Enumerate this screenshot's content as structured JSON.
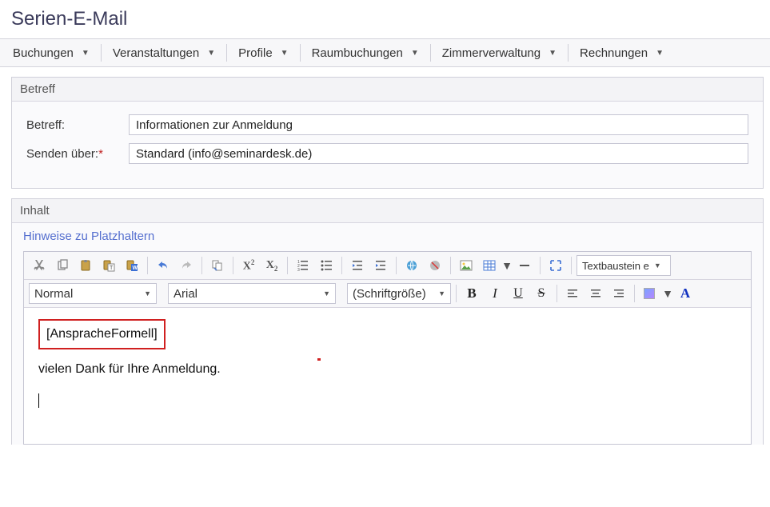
{
  "page_title": "Serien-E-Mail",
  "menubar": [
    "Buchungen",
    "Veranstaltungen",
    "Profile",
    "Raumbuchungen",
    "Zimmerverwaltung",
    "Rechnungen"
  ],
  "section_betreff": {
    "header": "Betreff",
    "label_betreff": "Betreff:",
    "value_betreff": "Informationen zur Anmeldung",
    "label_sender": "Senden über:",
    "value_sender": "Standard (info@seminardesk.de)"
  },
  "section_inhalt": {
    "header": "Inhalt",
    "hint_link": "Hinweise zu Platzhaltern"
  },
  "toolbar": {
    "textbaustein": "Textbaustein e",
    "format": "Normal",
    "font": "Arial",
    "size_label": "(Schriftgröße)"
  },
  "editor": {
    "placeholder": "[AnspracheFormell]",
    "line1": "vielen Dank für Ihre Anmeldung."
  }
}
